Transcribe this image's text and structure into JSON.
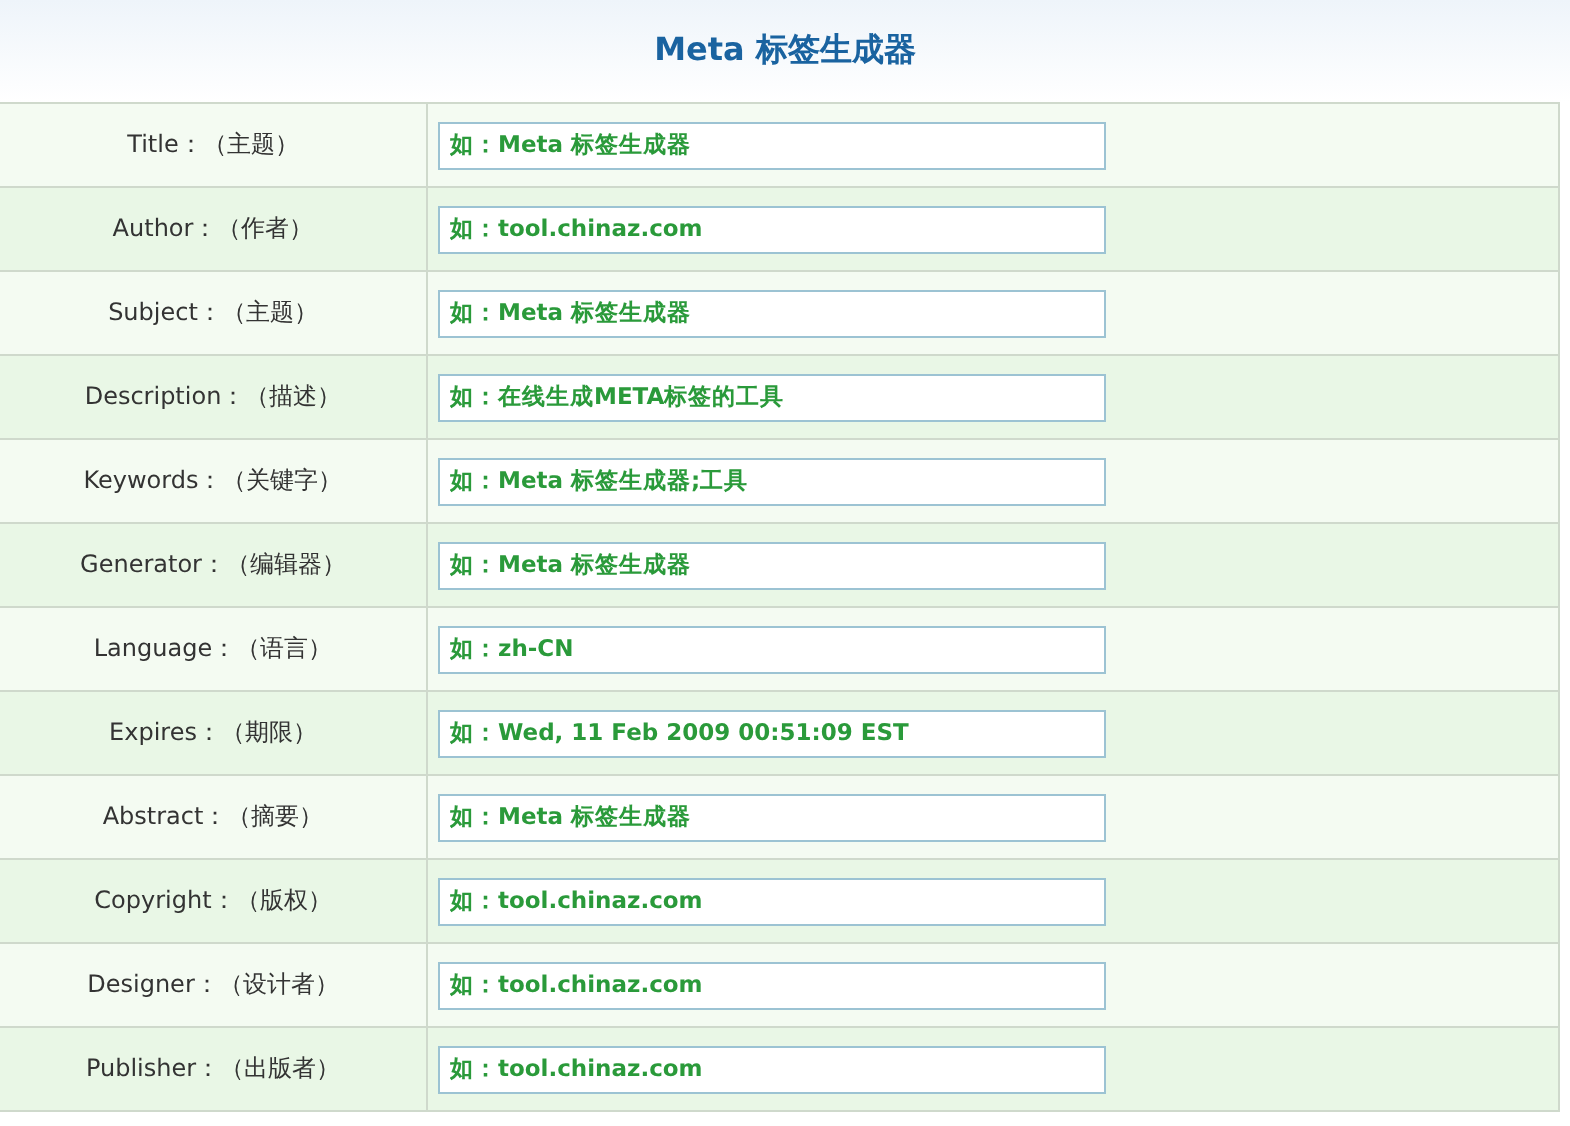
{
  "title": "Meta 标签生成器",
  "fields": [
    {
      "label": "Title：（主题）",
      "value": "如：Meta 标签生成器"
    },
    {
      "label": "Author：（作者）",
      "value": "如：tool.chinaz.com"
    },
    {
      "label": "Subject：（主题）",
      "value": "如：Meta 标签生成器"
    },
    {
      "label": "Description：（描述）",
      "value": "如：在线生成META标签的工具"
    },
    {
      "label": "Keywords：（关键字）",
      "value": "如：Meta 标签生成器;工具"
    },
    {
      "label": "Generator：（编辑器）",
      "value": "如：Meta 标签生成器"
    },
    {
      "label": "Language：（语言）",
      "value": "如：zh-CN"
    },
    {
      "label": "Expires：（期限）",
      "value": "如：Wed, 11 Feb 2009 00:51:09 EST"
    },
    {
      "label": "Abstract：（摘要）",
      "value": "如：Meta 标签生成器"
    },
    {
      "label": "Copyright：（版权）",
      "value": "如：tool.chinaz.com"
    },
    {
      "label": "Designer：（设计者）",
      "value": "如：tool.chinaz.com"
    },
    {
      "label": "Publisher：（出版者）",
      "value": "如：tool.chinaz.com"
    }
  ]
}
